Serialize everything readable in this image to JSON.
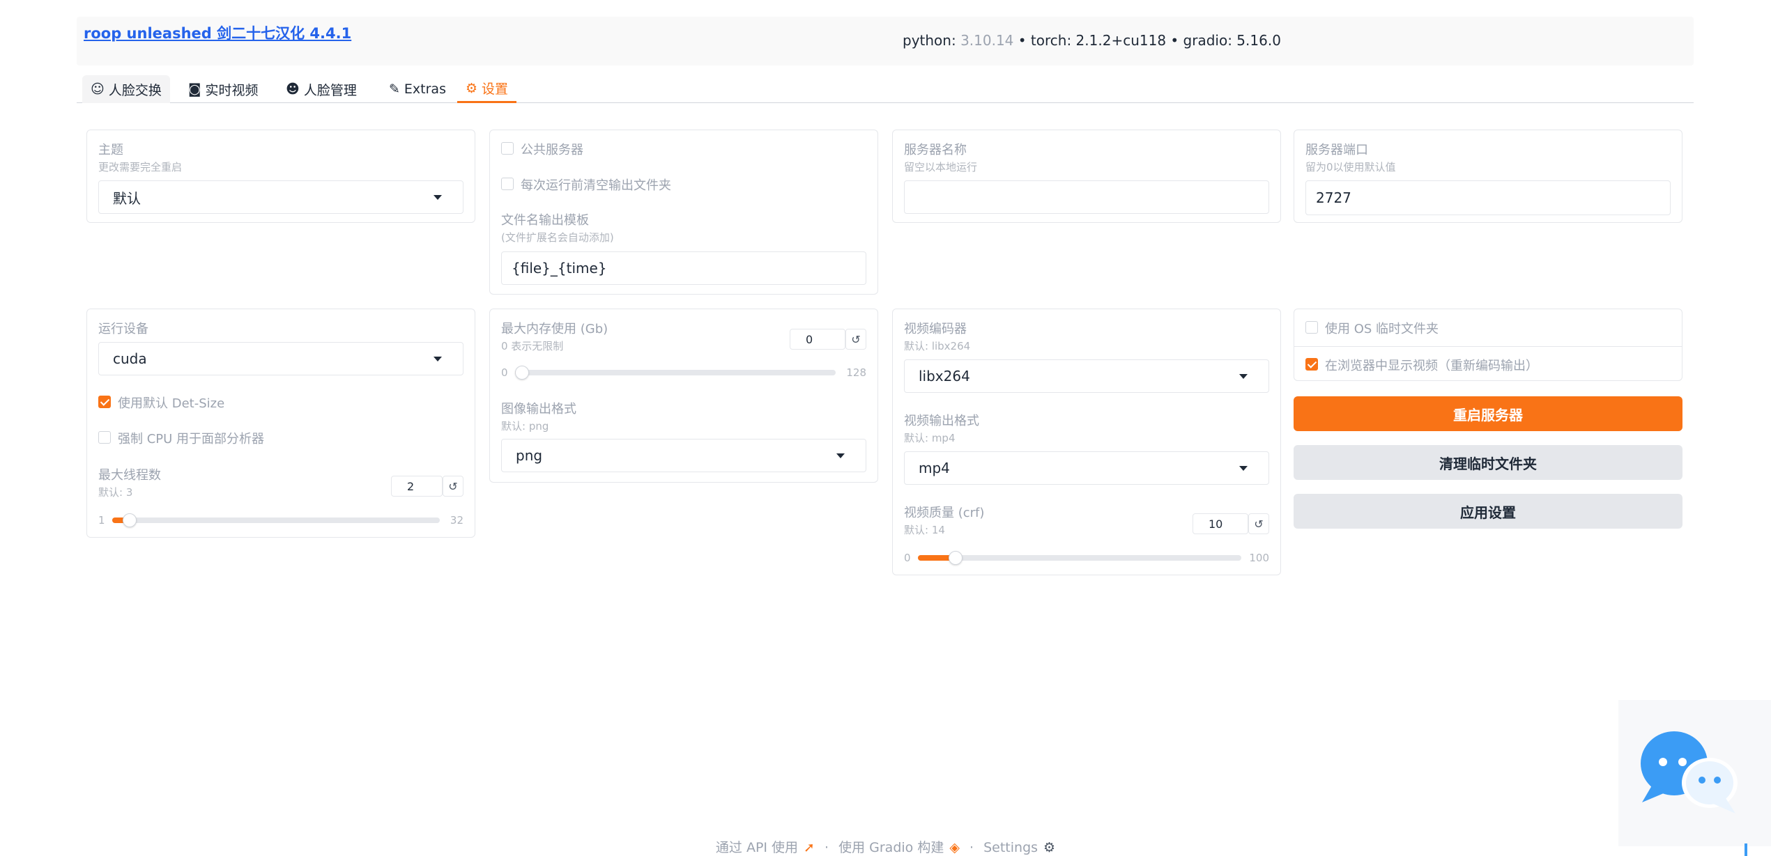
{
  "header": {
    "title": "roop unleashed 剑二十七汉化 4.4.1",
    "python_label": "python:",
    "python_version": "3.10.14",
    "torch_text": "• torch: 2.1.2+cu118 • gradio: 5.16.0"
  },
  "tabs": [
    {
      "label": "人脸交换",
      "icon": "face-swap-icon"
    },
    {
      "label": "实时视频",
      "icon": "live-video-icon"
    },
    {
      "label": "人脸管理",
      "icon": "face-management-icon"
    },
    {
      "label": "Extras",
      "icon": "extras-icon"
    },
    {
      "label": "设置",
      "icon": "settings-icon"
    }
  ],
  "active_tab": "设置",
  "theme": {
    "label": "主题",
    "info": "更改需要完全重启",
    "value": "默认"
  },
  "server_options": {
    "public_server": {
      "label": "公共服务器",
      "checked": false
    },
    "clear_output": {
      "label": "每次运行前清空输出文件夹",
      "checked": false
    },
    "filename_template": {
      "label": "文件名输出模板",
      "info": "(文件扩展名会自动添加)",
      "value": "{file}_{time}"
    }
  },
  "server_name": {
    "label": "服务器名称",
    "info": "留空以本地运行",
    "value": ""
  },
  "server_port": {
    "label": "服务器端口",
    "info": "留为0以使用默认值",
    "value": "2727"
  },
  "device": {
    "label": "运行设备",
    "value": "cuda",
    "default_det_size": {
      "label": "使用默认 Det-Size",
      "checked": true
    },
    "force_cpu": {
      "label": "强制 CPU 用于面部分析器",
      "checked": false
    },
    "max_threads": {
      "label": "最大线程数",
      "info": "默认: 3",
      "value": 2,
      "min": 1,
      "max": 32,
      "reset": "↺"
    }
  },
  "memory": {
    "label": "最大内存使用 (Gb)",
    "info": "0 表示无限制",
    "value": 0,
    "min": 0,
    "max": 128,
    "reset": "↺",
    "image_format": {
      "label": "图像输出格式",
      "info": "默认: png",
      "value": "png"
    }
  },
  "video": {
    "codec": {
      "label": "视频编码器",
      "info": "默认: libx264",
      "value": "libx264"
    },
    "format": {
      "label": "视频输出格式",
      "info": "默认: mp4",
      "value": "mp4"
    },
    "quality": {
      "label": "视频质量 (crf)",
      "info": "默认: 14",
      "value": 10,
      "min": 0,
      "max": 100,
      "reset": "↺"
    }
  },
  "misc": {
    "os_temp": {
      "label": "使用 OS 临时文件夹",
      "checked": false
    },
    "show_video": {
      "label": "在浏览器中显示视频（重新编码输出）",
      "checked": true
    }
  },
  "buttons": {
    "restart": "重启服务器",
    "clear_temp": "清理临时文件夹",
    "apply": "应用设置"
  },
  "footer": {
    "api": "通过 API 使用",
    "sep": "·",
    "built": "使用 Gradio 构建",
    "settings": "Settings"
  },
  "colors": {
    "accent": "#f97316",
    "link": "#2563eb",
    "chat_bubble": "#3b9cf5"
  }
}
